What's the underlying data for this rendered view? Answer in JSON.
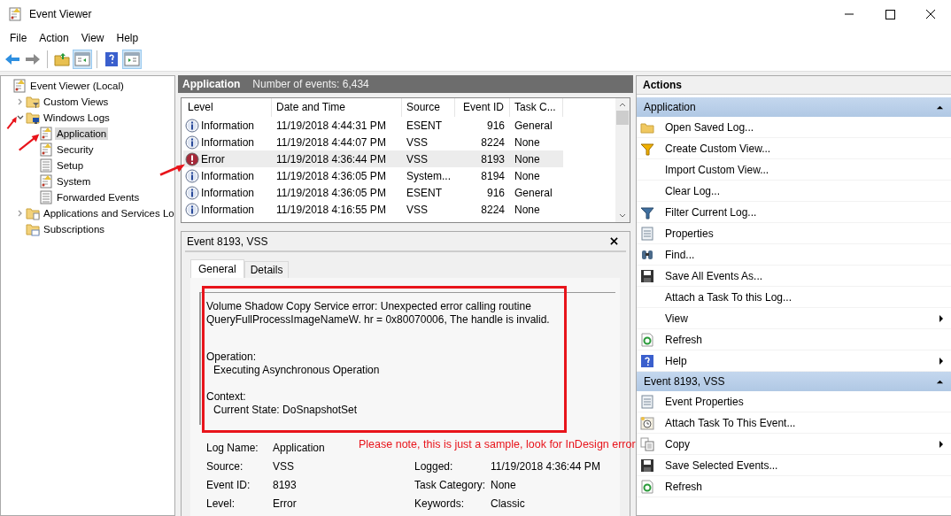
{
  "window": {
    "title": "Event Viewer"
  },
  "menu": [
    "File",
    "Action",
    "View",
    "Help"
  ],
  "tree": [
    {
      "label": "Event Viewer (Local)",
      "selected": false,
      "children": [
        {
          "label": "Custom Views",
          "selected": false,
          "expanded": false
        },
        {
          "label": "Windows Logs",
          "selected": false,
          "expanded": true,
          "children": [
            {
              "label": "Application",
              "selected": true
            },
            {
              "label": "Security",
              "selected": false
            },
            {
              "label": "Setup",
              "selected": false
            },
            {
              "label": "System",
              "selected": false
            },
            {
              "label": "Forwarded Events",
              "selected": false
            }
          ]
        },
        {
          "label": "Applications and Services Lo",
          "selected": false,
          "expanded": false
        },
        {
          "label": "Subscriptions",
          "selected": false
        }
      ]
    }
  ],
  "list_header": {
    "title": "Application",
    "count": "Number of events: 6,434"
  },
  "table": {
    "columns": [
      "Level",
      "Date and Time",
      "Source",
      "Event ID",
      "Task C..."
    ],
    "rows": [
      {
        "kind": "info",
        "selected": false,
        "cells": [
          "Information",
          "11/19/2018 4:44:31 PM",
          "ESENT",
          "916",
          "General"
        ]
      },
      {
        "kind": "info",
        "selected": false,
        "cells": [
          "Information",
          "11/19/2018 4:44:07 PM",
          "VSS",
          "8224",
          "None"
        ]
      },
      {
        "kind": "error",
        "selected": true,
        "cells": [
          "Error",
          "11/19/2018 4:36:44 PM",
          "VSS",
          "8193",
          "None"
        ]
      },
      {
        "kind": "info",
        "selected": false,
        "cells": [
          "Information",
          "11/19/2018 4:36:05 PM",
          "System...",
          "8194",
          "None"
        ]
      },
      {
        "kind": "info",
        "selected": false,
        "cells": [
          "Information",
          "11/19/2018 4:36:05 PM",
          "ESENT",
          "916",
          "General"
        ]
      },
      {
        "kind": "info",
        "selected": false,
        "cells": [
          "Information",
          "11/19/2018 4:16:55 PM",
          "VSS",
          "8224",
          "None"
        ]
      }
    ]
  },
  "detail": {
    "title": "Event 8193, VSS",
    "tabs": [
      {
        "label": "General",
        "selected": true
      },
      {
        "label": "Details",
        "selected": false
      }
    ],
    "message": {
      "summary": "Volume Shadow Copy Service error: Unexpected error calling routine QueryFullProcessImageNameW.  hr = 0x80070006, The handle is invalid.",
      "sections": [
        {
          "label": "Operation:",
          "value": "Executing Asynchronous Operation"
        },
        {
          "label": "Context:",
          "value": "Current State: DoSnapshotSet"
        }
      ]
    },
    "fields_left": [
      {
        "label": "Log Name:",
        "value": "Application"
      },
      {
        "label": "Source:",
        "value": "VSS"
      },
      {
        "label": "Event ID:",
        "value": "8193"
      },
      {
        "label": "Level:",
        "value": "Error"
      }
    ],
    "fields_right": [
      {
        "label": "Logged:",
        "value": "11/19/2018 4:36:44 PM"
      },
      {
        "label": "Task Category:",
        "value": "None"
      },
      {
        "label": "Keywords:",
        "value": "Classic"
      }
    ]
  },
  "actions": {
    "title": "Actions",
    "sections": [
      {
        "title": "Application",
        "expanded": true,
        "items": [
          {
            "label": "Open Saved Log...",
            "submenu": false
          },
          {
            "label": "Create Custom View...",
            "submenu": false
          },
          {
            "label": "Import Custom View...",
            "submenu": false
          },
          {
            "label": "Clear Log...",
            "submenu": false
          },
          {
            "label": "Filter Current Log...",
            "submenu": false
          },
          {
            "label": "Properties",
            "submenu": false
          },
          {
            "label": "Find...",
            "submenu": false
          },
          {
            "label": "Save All Events As...",
            "submenu": false
          },
          {
            "label": "Attach a Task To this Log...",
            "submenu": false
          },
          {
            "label": "View",
            "submenu": true
          },
          {
            "label": "Refresh",
            "submenu": false
          },
          {
            "label": "Help",
            "submenu": true
          }
        ]
      },
      {
        "title": "Event 8193, VSS",
        "expanded": true,
        "items": [
          {
            "label": "Event Properties",
            "submenu": false
          },
          {
            "label": "Attach Task To This Event...",
            "submenu": false
          },
          {
            "label": "Copy",
            "submenu": true
          },
          {
            "label": "Save Selected Events...",
            "submenu": false
          },
          {
            "label": "Refresh",
            "submenu": false
          }
        ]
      }
    ]
  },
  "annotation": {
    "note": "Please note, this is just a sample, look for InDesign error"
  }
}
